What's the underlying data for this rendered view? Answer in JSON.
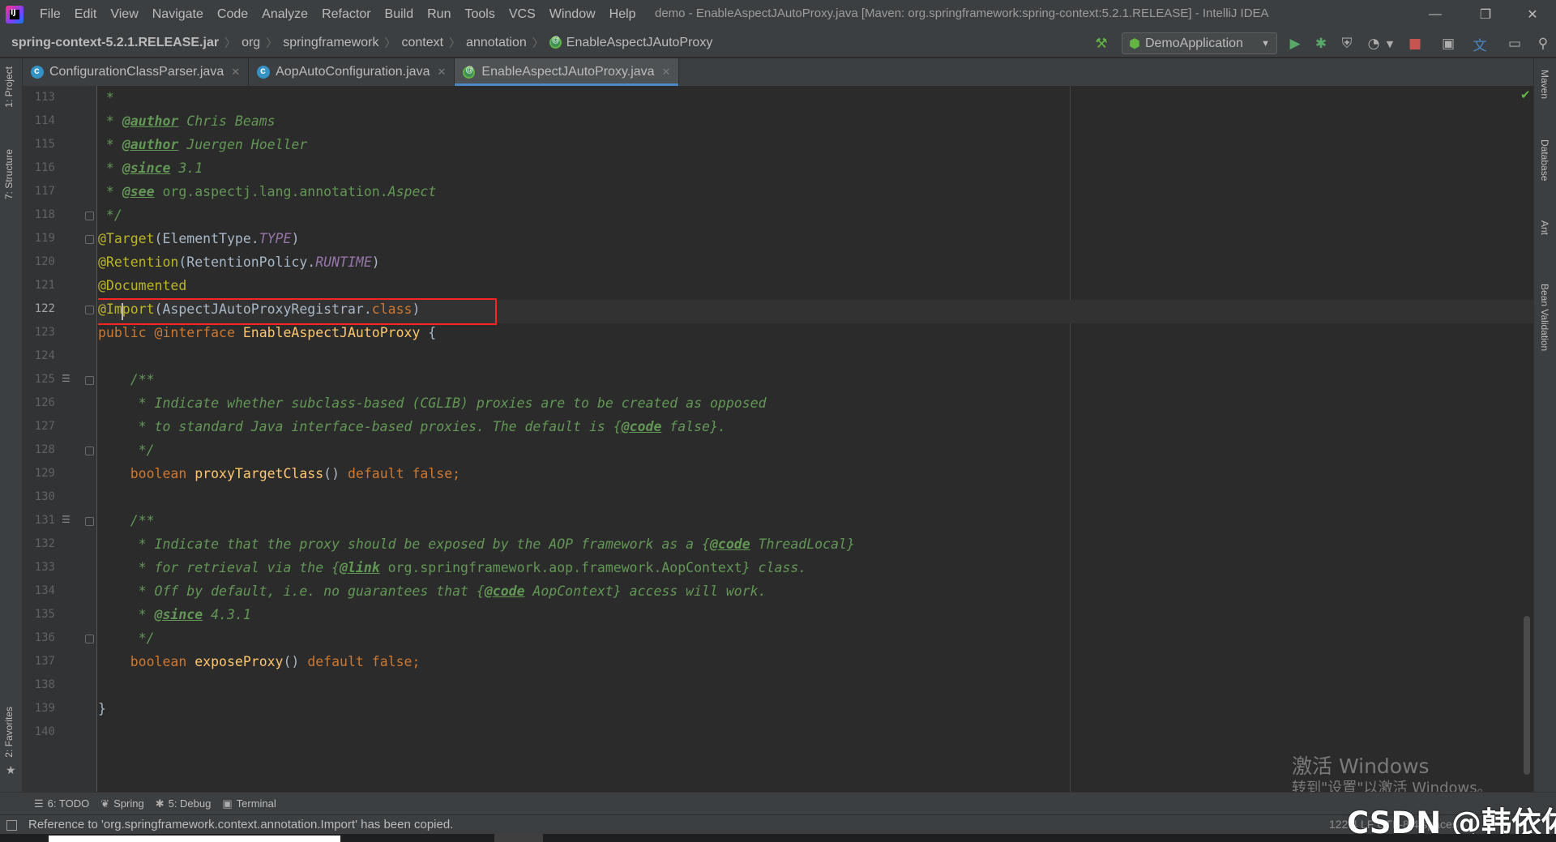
{
  "window": {
    "title": "demo - EnableAspectJAutoProxy.java [Maven: org.springframework:spring-context:5.2.1.RELEASE] - IntelliJ IDEA",
    "minimize": "—",
    "restore": "❐",
    "close": "✕"
  },
  "menu": [
    "File",
    "Edit",
    "View",
    "Navigate",
    "Code",
    "Analyze",
    "Refactor",
    "Build",
    "Run",
    "Tools",
    "VCS",
    "Window",
    "Help"
  ],
  "breadcrumb": [
    "spring-context-5.2.1.RELEASE.jar",
    "org",
    "springframework",
    "context",
    "annotation",
    "EnableAspectJAutoProxy"
  ],
  "toolbar": {
    "run_config": "DemoApplication"
  },
  "tabs": [
    {
      "label": "ConfigurationClassParser.java",
      "icon": "class-icon",
      "active": false
    },
    {
      "label": "AopAutoConfiguration.java",
      "icon": "class-icon",
      "active": false
    },
    {
      "label": "EnableAspectJAutoProxy.java",
      "icon": "annotation-icon",
      "active": true
    }
  ],
  "left_tools": [
    "1: Project",
    "7: Structure",
    "2: Favorites"
  ],
  "right_tools": [
    "Maven",
    "Database",
    "Ant",
    "Bean Validation"
  ],
  "editor": {
    "line_numbers": [
      "113",
      "114",
      "115",
      "116",
      "117",
      "118",
      "119",
      "120",
      "121",
      "122",
      "123",
      "124",
      "125",
      "126",
      "127",
      "128",
      "129",
      "130",
      "131",
      "132",
      "133",
      "134",
      "135",
      "136",
      "137",
      "138",
      "139",
      "140"
    ],
    "current_line": "122",
    "highlighted_line": "@Import(AspectJAutoProxyRegistrar.class)"
  },
  "tool_windows": [
    {
      "icon": "list-icon",
      "label": "6: TODO"
    },
    {
      "icon": "leaf-icon",
      "label": "Spring"
    },
    {
      "icon": "bug-icon",
      "label": "5: Debug"
    },
    {
      "icon": "terminal-icon",
      "label": "Terminal"
    }
  ],
  "status": {
    "message": "Reference to 'org.springframework.context.annotation.Import' has been copied.",
    "position": "122:4   LF   UTF-8   4 spaces"
  },
  "watermark": {
    "activate_title": "激活 Windows",
    "activate_sub": "转到\"设置\"以激活 Windows。",
    "csdn": "CSDN @韩依佑"
  },
  "colors": {
    "background": "#2b2b2b",
    "comment": "#629755",
    "annotation": "#bbb529",
    "keyword": "#cc7832",
    "highlight_box": "#ff2424"
  }
}
